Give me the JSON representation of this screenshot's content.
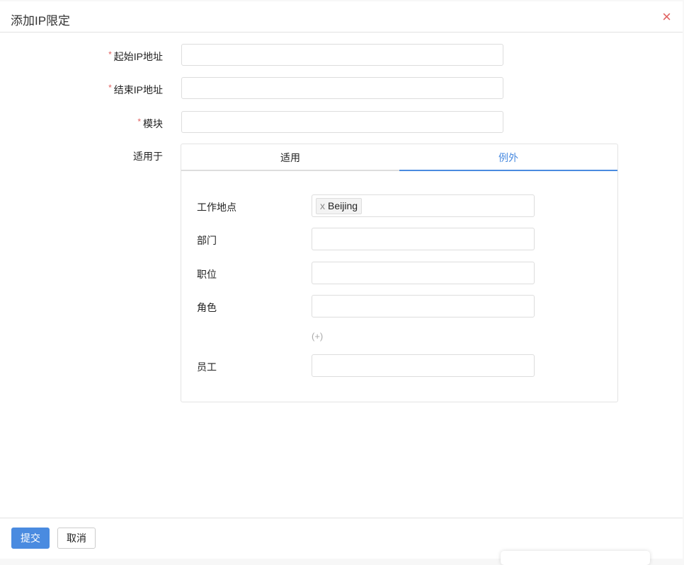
{
  "dialog": {
    "title": "添加IP限定",
    "close_icon": "×"
  },
  "form": {
    "required_mark": "*",
    "start_ip": {
      "label": "起始IP地址",
      "value": ""
    },
    "end_ip": {
      "label": "结束IP地址",
      "value": ""
    },
    "module": {
      "label": "模块",
      "value": ""
    },
    "applies_to": {
      "label": "适用于"
    }
  },
  "tabs": [
    {
      "label": "适用",
      "active": false
    },
    {
      "label": "例外",
      "active": true
    }
  ],
  "panel": {
    "location": {
      "label": "工作地点",
      "chips": [
        {
          "remove": "x",
          "label": "Beijing"
        }
      ]
    },
    "department": {
      "label": "部门"
    },
    "position": {
      "label": "职位"
    },
    "role": {
      "label": "角色"
    },
    "add": "(+)",
    "employee": {
      "label": "员工"
    }
  },
  "footer": {
    "submit": "提交",
    "cancel": "取消"
  },
  "colors": {
    "accent": "#4a8be0",
    "required": "#e0605f"
  }
}
